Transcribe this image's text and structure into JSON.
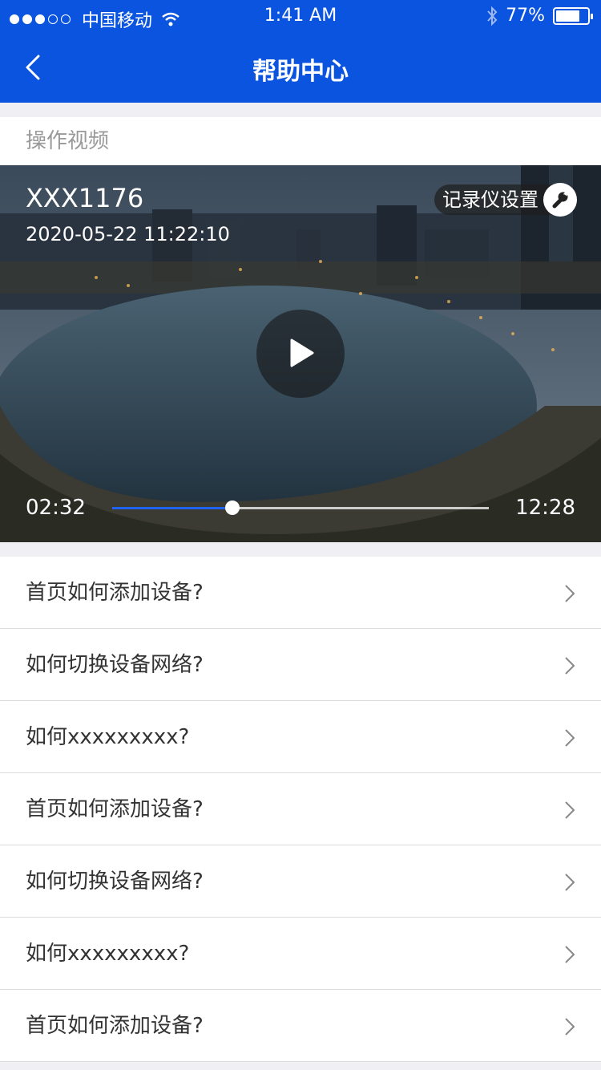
{
  "status": {
    "carrier": "中国移动",
    "time": "1:41 AM",
    "battery": "77%",
    "battery_level": 0.77,
    "signal_strength": 3
  },
  "nav": {
    "title": "帮助中心"
  },
  "section": {
    "title": "操作视频"
  },
  "video": {
    "device": "XXX1176",
    "datetime": "2020-05-22  11:22:10",
    "settings_label": "记录仪设置",
    "current_time": "02:32",
    "total_time": "12:28",
    "progress": 0.32
  },
  "faq": [
    {
      "label": "首页如何添加设备?"
    },
    {
      "label": "如何切换设备网络?"
    },
    {
      "label": "如何xxxxxxxxx?"
    },
    {
      "label": "首页如何添加设备?"
    },
    {
      "label": "如何切换设备网络?"
    },
    {
      "label": "如何xxxxxxxxx?"
    },
    {
      "label": "首页如何添加设备?"
    }
  ],
  "colors": {
    "brand": "#0b54e0",
    "progress": "#1f63f0"
  }
}
